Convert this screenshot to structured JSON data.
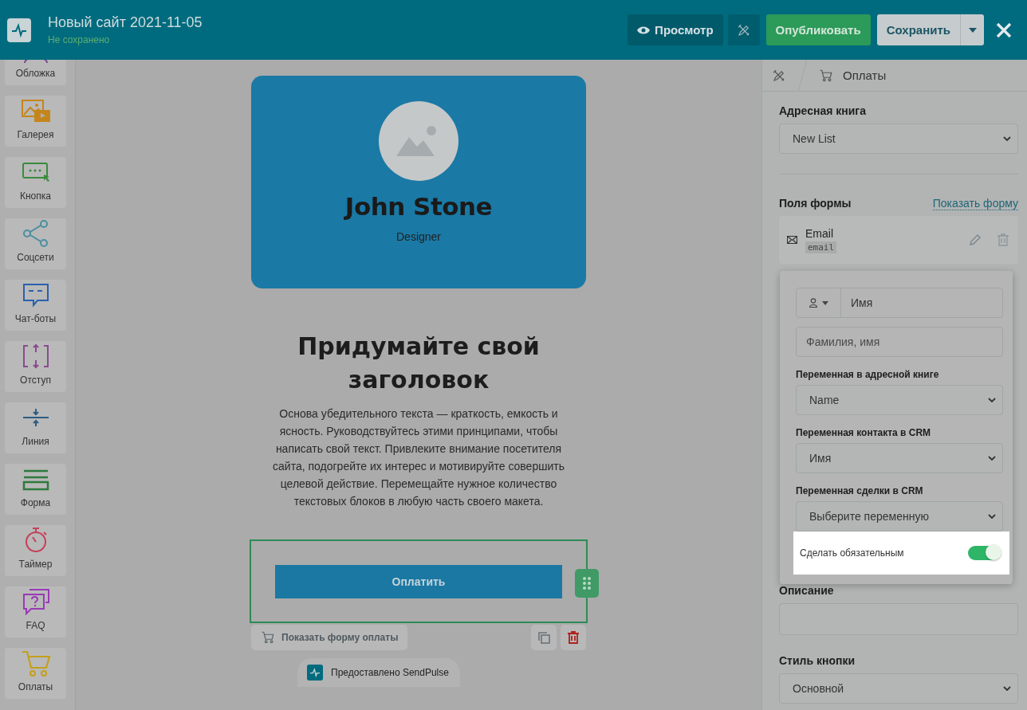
{
  "header": {
    "title": "Новый сайт 2021-11-05",
    "status": "Не сохранено",
    "buttons": [
      {
        "kind": "preview",
        "label": "Просмотр"
      },
      {
        "kind": "tools"
      },
      {
        "kind": "publish",
        "label": "Опубликовать"
      },
      {
        "kind": "save",
        "label": "Сохранить"
      },
      {
        "kind": "dropdown"
      },
      {
        "kind": "close"
      }
    ]
  },
  "sidebar": {
    "items": [
      {
        "kind": "cover",
        "label": "Обложка"
      },
      {
        "kind": "gallery",
        "label": "Галерея"
      },
      {
        "kind": "button",
        "label": "Кнопка"
      },
      {
        "kind": "social",
        "label": "Соцсети"
      },
      {
        "kind": "chatbot",
        "label": "Чат-боты"
      },
      {
        "kind": "indent",
        "label": "Отступ"
      },
      {
        "kind": "line",
        "label": "Линия"
      },
      {
        "kind": "form",
        "label": "Форма"
      },
      {
        "kind": "timer",
        "label": "Таймер"
      },
      {
        "kind": "faq",
        "label": "FAQ"
      },
      {
        "kind": "cart",
        "label": "Оплаты"
      }
    ]
  },
  "canvas": {
    "profile": {
      "name": "John Stone",
      "role": "Designer"
    },
    "heading": "Придумайте свой заголовок",
    "paragraph": "Основа убедительного текста — краткость, емкость и ясность. Руководствуйтесь этими принципами, чтобы написать свой текст. Привлеките внимание посетителя сайта, подогрейте их интерес и мотивируйте совершить целевой действие. Перемещайте нужное количество текстовых блоков в любую часть своего макета.",
    "pay_button": "Оплатить",
    "show_form": "Показать форму оплаты",
    "footer": "Предоставлено SendPulse"
  },
  "panel": {
    "breadcrumb": "Оплаты",
    "address_book": {
      "label": "Адресная книга",
      "value": "New List"
    },
    "form_fields": {
      "label": "Поля формы",
      "link": "Показать форму",
      "items": [
        {
          "name": "Email",
          "tag": "email"
        }
      ]
    },
    "popup": {
      "name_value": "Имя",
      "placeholder": "Фамилия, имя",
      "selects": [
        {
          "label": "Переменная в адресной книге",
          "value": "Name"
        },
        {
          "label": "Переменная контакта в CRM",
          "value": "Имя"
        },
        {
          "label": "Переменная сделки в CRM",
          "value": "Выберите переменную"
        }
      ],
      "toggle": {
        "label": "Сделать обязательным",
        "on": true
      }
    },
    "description": {
      "label": "Описание"
    },
    "button_style": {
      "label": "Стиль кнопки",
      "value": "Основной"
    }
  }
}
